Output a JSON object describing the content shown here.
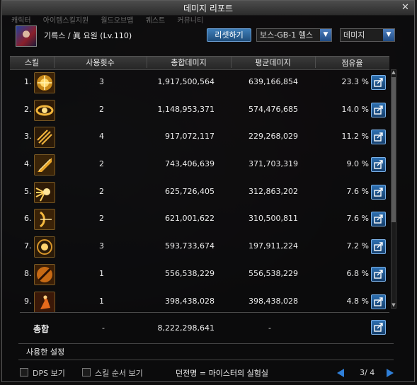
{
  "window": {
    "title": "데미지 리포트"
  },
  "background_tabs": [
    "캐릭터",
    "아이템스킬지원",
    "월드오브맵",
    "퀘스트",
    "커뮤니티"
  ],
  "character": {
    "name": "기륵스 / 眞 요원 (Lv.110)"
  },
  "controls": {
    "reset_label": "리셋하기",
    "boss_dropdown": "보스-GB-1 헬스",
    "metric_dropdown": "데미지"
  },
  "table": {
    "headers": {
      "skill": "스킬",
      "count": "사용횟수",
      "total": "총합데미지",
      "average": "평균데미지",
      "share": "점유율"
    },
    "rows": [
      {
        "rank": "1.",
        "icon": "skill-icon-gold-burst",
        "count": "3",
        "total": "1,917,500,564",
        "avg": "639,166,854",
        "share": "23.3 %"
      },
      {
        "rank": "2.",
        "icon": "skill-icon-spin-slash",
        "count": "2",
        "total": "1,148,953,371",
        "avg": "574,476,685",
        "share": "14.0 %"
      },
      {
        "rank": "3.",
        "icon": "skill-icon-triple-strike",
        "count": "4",
        "total": "917,072,117",
        "avg": "229,268,029",
        "share": "11.2 %"
      },
      {
        "rank": "4.",
        "icon": "skill-icon-golden-edge",
        "count": "2",
        "total": "743,406,639",
        "avg": "371,703,319",
        "share": "9.0 %"
      },
      {
        "rank": "5.",
        "icon": "skill-icon-light-burst",
        "count": "2",
        "total": "625,726,405",
        "avg": "312,863,202",
        "share": "7.6 %"
      },
      {
        "rank": "6.",
        "icon": "skill-icon-crescent-bow",
        "count": "2",
        "total": "621,001,622",
        "avg": "310,500,811",
        "share": "7.6 %"
      },
      {
        "rank": "7.",
        "icon": "skill-icon-orb-target",
        "count": "3",
        "total": "593,733,674",
        "avg": "197,911,224",
        "share": "7.2 %"
      },
      {
        "rank": "8.",
        "icon": "skill-icon-slash-disc",
        "count": "1",
        "total": "556,538,229",
        "avg": "556,538,229",
        "share": "6.8 %"
      },
      {
        "rank": "9.",
        "icon": "skill-icon-running-flame",
        "count": "1",
        "total": "398,438,028",
        "avg": "398,438,028",
        "share": "4.8 %"
      }
    ],
    "total": {
      "label": "총합",
      "count": "-",
      "sum": "8,222,298,641",
      "avg": "-"
    }
  },
  "settings": {
    "label": "사용한 설정"
  },
  "footer": {
    "dps_label": "DPS 보기",
    "order_label": "스킬 순서 보기",
    "legend": "던전명 = 마이스터의 실험실",
    "page": "3/ 4"
  },
  "colors": {
    "accent": "#2f7fd8",
    "gold": "#e0a22a"
  }
}
